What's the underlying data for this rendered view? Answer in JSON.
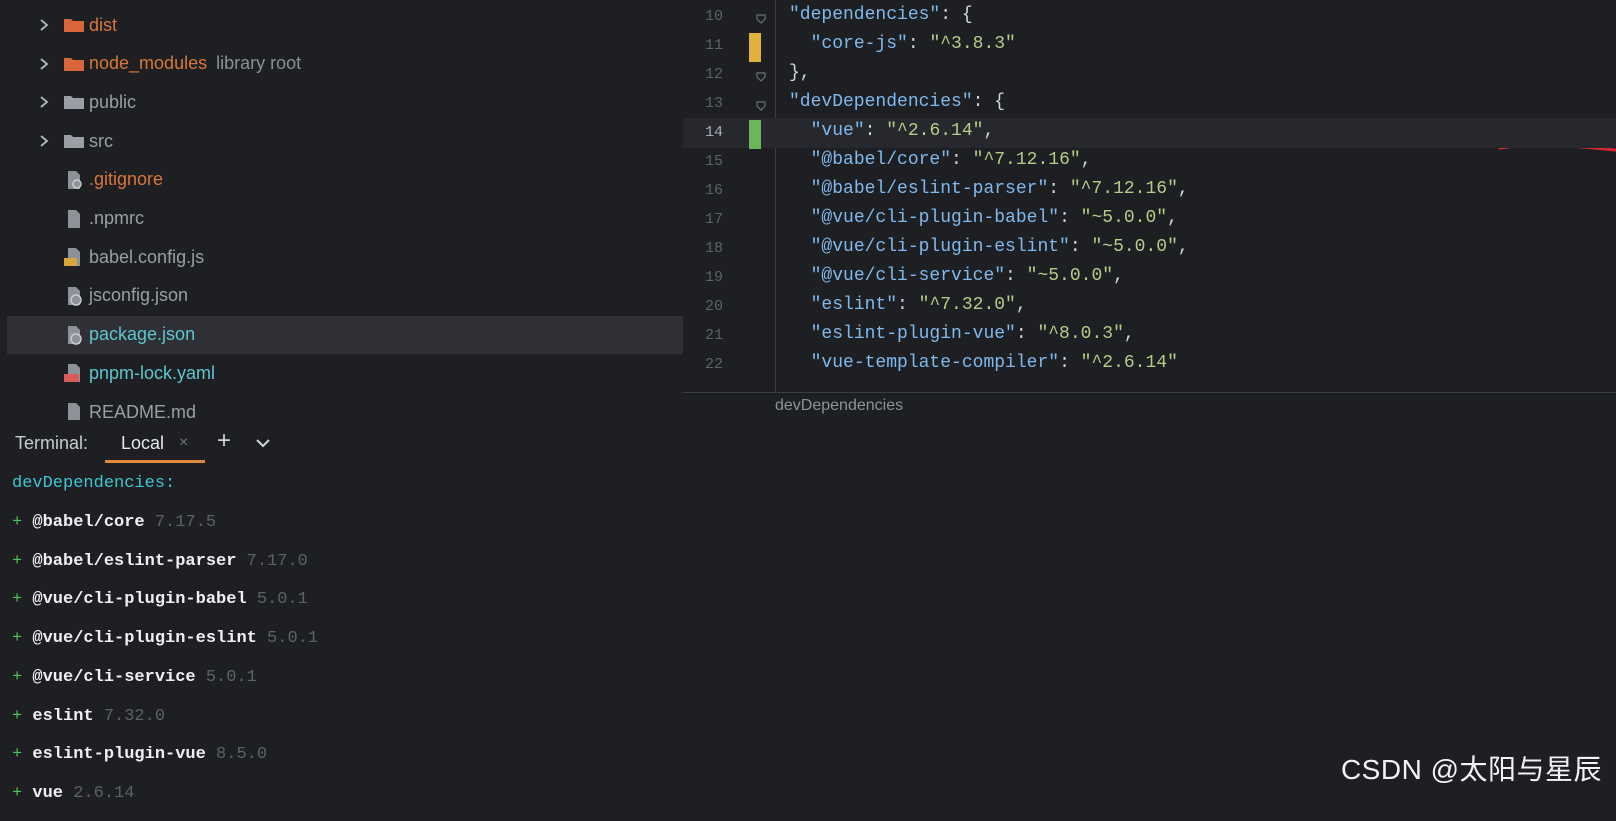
{
  "project_tree": {
    "items": [
      {
        "label": "dist",
        "suffix": "",
        "kind": "folder",
        "icon": "folder-icon",
        "color": "orange",
        "expandable": true
      },
      {
        "label": "node_modules",
        "suffix": "library root",
        "kind": "folder",
        "icon": "folder-icon",
        "color": "orange",
        "expandable": true
      },
      {
        "label": "public",
        "suffix": "",
        "kind": "folder",
        "icon": "folder-icon",
        "color": "gray",
        "expandable": true
      },
      {
        "label": "src",
        "suffix": "",
        "kind": "folder",
        "icon": "folder-icon",
        "color": "gray",
        "expandable": true
      },
      {
        "label": ".gitignore",
        "suffix": "",
        "kind": "file",
        "icon": "gitignore-file-icon",
        "color": "orange",
        "expandable": false
      },
      {
        "label": ".npmrc",
        "suffix": "",
        "kind": "file",
        "icon": "config-file-icon",
        "color": "gray",
        "expandable": false
      },
      {
        "label": "babel.config.js",
        "suffix": "",
        "kind": "file",
        "icon": "js-file-icon",
        "color": "gray",
        "expandable": false
      },
      {
        "label": "jsconfig.json",
        "suffix": "",
        "kind": "file",
        "icon": "json-file-icon",
        "color": "gray",
        "expandable": false
      },
      {
        "label": "package.json",
        "suffix": "",
        "kind": "file",
        "icon": "json-file-icon",
        "color": "teal",
        "expandable": false,
        "selected": true
      },
      {
        "label": "pnpm-lock.yaml",
        "suffix": "",
        "kind": "file",
        "icon": "yaml-file-icon",
        "color": "teal",
        "expandable": false
      },
      {
        "label": "README.md",
        "suffix": "",
        "kind": "file",
        "icon": "markdown-file-icon",
        "color": "gray",
        "expandable": false
      }
    ]
  },
  "editor": {
    "lines": [
      {
        "num": "10",
        "tokens": [
          [
            "k",
            "\"dependencies\""
          ],
          [
            "p",
            ": {"
          ]
        ],
        "fold": true
      },
      {
        "num": "11",
        "tokens": [
          [
            "p",
            "  "
          ],
          [
            "k",
            "\"core-js\""
          ],
          [
            "p",
            ": "
          ],
          [
            "s",
            "\"^3.8.3\""
          ]
        ],
        "marker": "modified"
      },
      {
        "num": "12",
        "tokens": [
          [
            "p",
            "},"
          ]
        ],
        "fold": true
      },
      {
        "num": "13",
        "tokens": [
          [
            "k",
            "\"devDependencies\""
          ],
          [
            "p",
            ": {"
          ]
        ],
        "fold": true
      },
      {
        "num": "14",
        "tokens": [
          [
            "p",
            "  "
          ],
          [
            "k",
            "\"vue\""
          ],
          [
            "p",
            ": "
          ],
          [
            "s",
            "\"^2.6.14\""
          ],
          [
            "p",
            ","
          ]
        ],
        "marker": "added",
        "current": true
      },
      {
        "num": "15",
        "tokens": [
          [
            "p",
            "  "
          ],
          [
            "k",
            "\"@babel/core\""
          ],
          [
            "p",
            ": "
          ],
          [
            "s",
            "\"^7.12.16\""
          ],
          [
            "p",
            ","
          ]
        ]
      },
      {
        "num": "16",
        "tokens": [
          [
            "p",
            "  "
          ],
          [
            "k",
            "\"@babel/eslint-parser\""
          ],
          [
            "p",
            ": "
          ],
          [
            "s",
            "\"^7.12.16\""
          ],
          [
            "p",
            ","
          ]
        ]
      },
      {
        "num": "17",
        "tokens": [
          [
            "p",
            "  "
          ],
          [
            "k",
            "\"@vue/cli-plugin-babel\""
          ],
          [
            "p",
            ": "
          ],
          [
            "s",
            "\"~5.0.0\""
          ],
          [
            "p",
            ","
          ]
        ]
      },
      {
        "num": "18",
        "tokens": [
          [
            "p",
            "  "
          ],
          [
            "k",
            "\"@vue/cli-plugin-eslint\""
          ],
          [
            "p",
            ": "
          ],
          [
            "s",
            "\"~5.0.0\""
          ],
          [
            "p",
            ","
          ]
        ]
      },
      {
        "num": "19",
        "tokens": [
          [
            "p",
            "  "
          ],
          [
            "k",
            "\"@vue/cli-service\""
          ],
          [
            "p",
            ": "
          ],
          [
            "s",
            "\"~5.0.0\""
          ],
          [
            "p",
            ","
          ]
        ]
      },
      {
        "num": "20",
        "tokens": [
          [
            "p",
            "  "
          ],
          [
            "k",
            "\"eslint\""
          ],
          [
            "p",
            ": "
          ],
          [
            "s",
            "\"^7.32.0\""
          ],
          [
            "p",
            ","
          ]
        ]
      },
      {
        "num": "21",
        "tokens": [
          [
            "p",
            "  "
          ],
          [
            "k",
            "\"eslint-plugin-vue\""
          ],
          [
            "p",
            ": "
          ],
          [
            "s",
            "\"^8.0.3\""
          ],
          [
            "p",
            ","
          ]
        ]
      },
      {
        "num": "22",
        "tokens": [
          [
            "p",
            "  "
          ],
          [
            "k",
            "\"vue-template-compiler\""
          ],
          [
            "p",
            ": "
          ],
          [
            "s",
            "\"^2.6.14\""
          ]
        ]
      }
    ],
    "breadcrumb": "devDependencies",
    "colors": {
      "key": "#7fb9ee",
      "string": "#b6cc87",
      "modified": "#e0b13c",
      "added": "#69b75a",
      "annotation": "#d8262f"
    }
  },
  "terminal": {
    "title": "Terminal:",
    "tab_label": "Local",
    "close_glyph": "×",
    "add_glyph": "+",
    "heading": "devDependencies:",
    "entries": [
      {
        "name": "@babel/core",
        "version": "7.17.5"
      },
      {
        "name": "@babel/eslint-parser",
        "version": "7.17.0"
      },
      {
        "name": "@vue/cli-plugin-babel",
        "version": "5.0.1"
      },
      {
        "name": "@vue/cli-plugin-eslint",
        "version": "5.0.1"
      },
      {
        "name": "@vue/cli-service",
        "version": "5.0.1"
      },
      {
        "name": "eslint",
        "version": "7.32.0"
      },
      {
        "name": "eslint-plugin-vue",
        "version": "8.5.0"
      },
      {
        "name": "vue",
        "version": "2.6.14"
      }
    ],
    "colors": {
      "heading": "#3fc5d4",
      "plus": "#4fc25a",
      "tab_underline": "#e0883b"
    }
  },
  "watermark": "CSDN @太阳与星辰"
}
